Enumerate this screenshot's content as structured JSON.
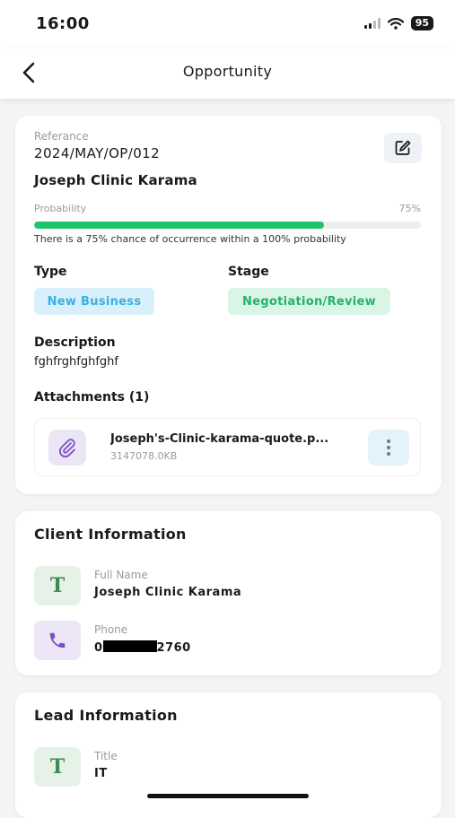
{
  "status_bar": {
    "time": "16:00",
    "battery": "95"
  },
  "nav": {
    "title": "Opportunity"
  },
  "opportunity": {
    "reference_label": "Referance",
    "reference_value": "2024/MAY/OP/012",
    "company": "Joseph Clinic Karama",
    "probability_label": "Probability",
    "probability_value": "75%",
    "probability_fraction": 0.75,
    "probability_note": "There is a 75% chance of occurrence within a 100% probability",
    "type_label": "Type",
    "type_value": "New Business",
    "stage_label": "Stage",
    "stage_value": "Negotiation/Review",
    "description_label": "Description",
    "description_value": "fghfrghfghfghf",
    "attachments_label": "Attachments (1)",
    "attachments": [
      {
        "name": "Joseph's-Clinic-karama-quote.p...",
        "size": "3147078.0KB"
      }
    ]
  },
  "client": {
    "heading": "Client Information",
    "full_name_label": "Full Name",
    "full_name_value": "Joseph Clinic Karama",
    "phone_label": "Phone",
    "phone_prefix": "0",
    "phone_suffix": "2760"
  },
  "lead": {
    "heading": "Lead Information",
    "title_label": "Title",
    "title_value": "IT"
  },
  "colors": {
    "progress": "#1fc46a",
    "type_chip": "#3ab0e2",
    "stage_chip": "#23b36a",
    "icon_green": "#3d8c53",
    "icon_purple": "#7b4fc0"
  }
}
